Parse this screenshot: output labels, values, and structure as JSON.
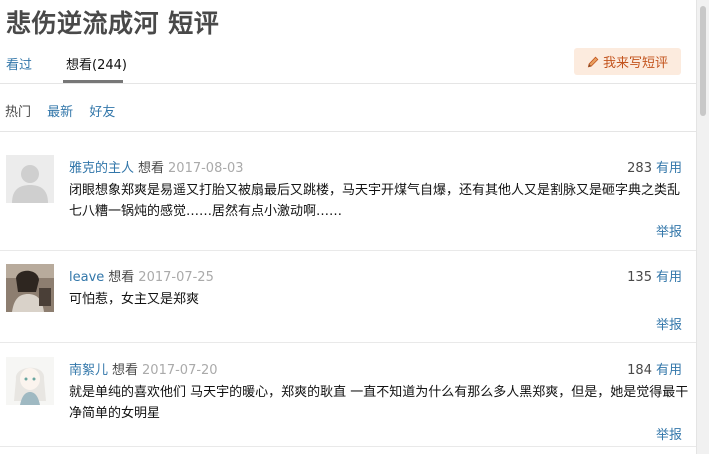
{
  "page": {
    "title": "悲伤逆流成河 短评"
  },
  "tabs": [
    {
      "label": "看过"
    },
    {
      "label": "想看(244)"
    }
  ],
  "write_button": {
    "label": "我来写短评",
    "icon": "pencil-icon"
  },
  "sorts": [
    {
      "label": "热门"
    },
    {
      "label": "最新"
    },
    {
      "label": "好友"
    }
  ],
  "comments": [
    {
      "user": "雅克的主人",
      "status": "想看",
      "date": "2017-08-03",
      "votes": "283",
      "vote_label": "有用",
      "content": "闭眼想象郑爽是易遥又打胎又被扇最后又跳楼，马天宇开煤气自爆，还有其他人又是割脉又是砸字典之类乱七八糟一锅炖的感觉……居然有点小激动啊……",
      "report": "举报"
    },
    {
      "user": "leave",
      "status": "想看",
      "date": "2017-07-25",
      "votes": "135",
      "vote_label": "有用",
      "content": "可怕惹，女主又是郑爽",
      "report": "举报"
    },
    {
      "user": "南絮儿",
      "status": "想看",
      "date": "2017-07-20",
      "votes": "184",
      "vote_label": "有用",
      "content": "就是单纯的喜欢他们 马天宇的暖心，郑爽的耿直 一直不知道为什么有那么多人黑郑爽，但是，她是觉得最干净简单的女明星",
      "report": "举报"
    }
  ]
}
